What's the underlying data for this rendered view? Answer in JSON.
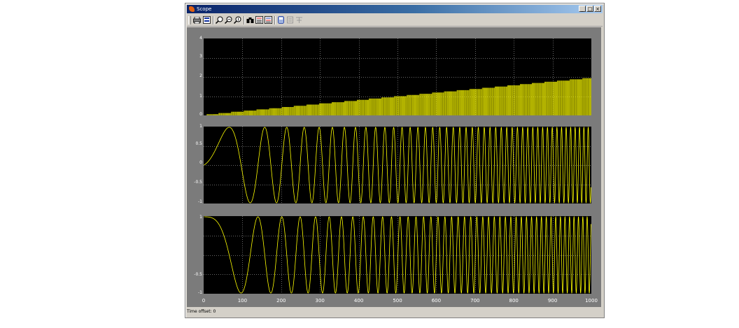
{
  "window": {
    "title": "Scope",
    "minimize": "_",
    "maximize": "□",
    "close": "×"
  },
  "toolbar": {
    "print_icon": "printer-icon",
    "params_icon": "parameters-icon",
    "zoom_icon": "zoom-icon",
    "zoom_x_icon": "zoom-x-icon",
    "zoom_y_icon": "zoom-y-icon",
    "autoscale_icon": "binoculars-icon",
    "save_axes_icon": "save-axes-icon",
    "restore_axes_icon": "restore-axes-icon",
    "floating_icon": "floating-scope-icon",
    "lock_icon": "lock-axes-icon",
    "signal_icon": "signal-selection-icon"
  },
  "status": "Time offset: 0",
  "chart_data": [
    {
      "type": "line",
      "title": "",
      "ylim": [
        0,
        4
      ],
      "yticks": [
        "4",
        "3",
        "2",
        "1",
        "0"
      ],
      "xlim": [
        0,
        1000
      ],
      "color": "#ffff00",
      "series": [
        {
          "desc": "increasing staircase / chirp frequency",
          "x": [
            0,
            1000
          ],
          "values": [
            0.02,
            1.95
          ]
        }
      ]
    },
    {
      "type": "line",
      "ylim": [
        -1,
        1
      ],
      "yticks": [
        "1",
        "0.5",
        "0",
        "-0.5",
        "-1"
      ],
      "xlim": [
        0,
        1000
      ],
      "color": "#ffff00",
      "series": [
        {
          "desc": "chirp sine wave, amplitude 1"
        }
      ]
    },
    {
      "type": "line",
      "ylim": [
        -1,
        1
      ],
      "yticks": [
        "1",
        "",
        "",
        "-0.5",
        "-1"
      ],
      "xlim": [
        0,
        1000
      ],
      "xticks": [
        "0",
        "100",
        "200",
        "300",
        "400",
        "500",
        "600",
        "700",
        "800",
        "900",
        "1000"
      ],
      "color": "#ffff00",
      "series": [
        {
          "desc": "chirp cosine wave, amplitude 1"
        }
      ]
    }
  ],
  "colors": {
    "window_face": "#d4d0c8",
    "scope_bg": "#7b7b7b",
    "axes_bg": "#000000",
    "trace": "#ffff00",
    "grid": "#cfcfcf"
  }
}
